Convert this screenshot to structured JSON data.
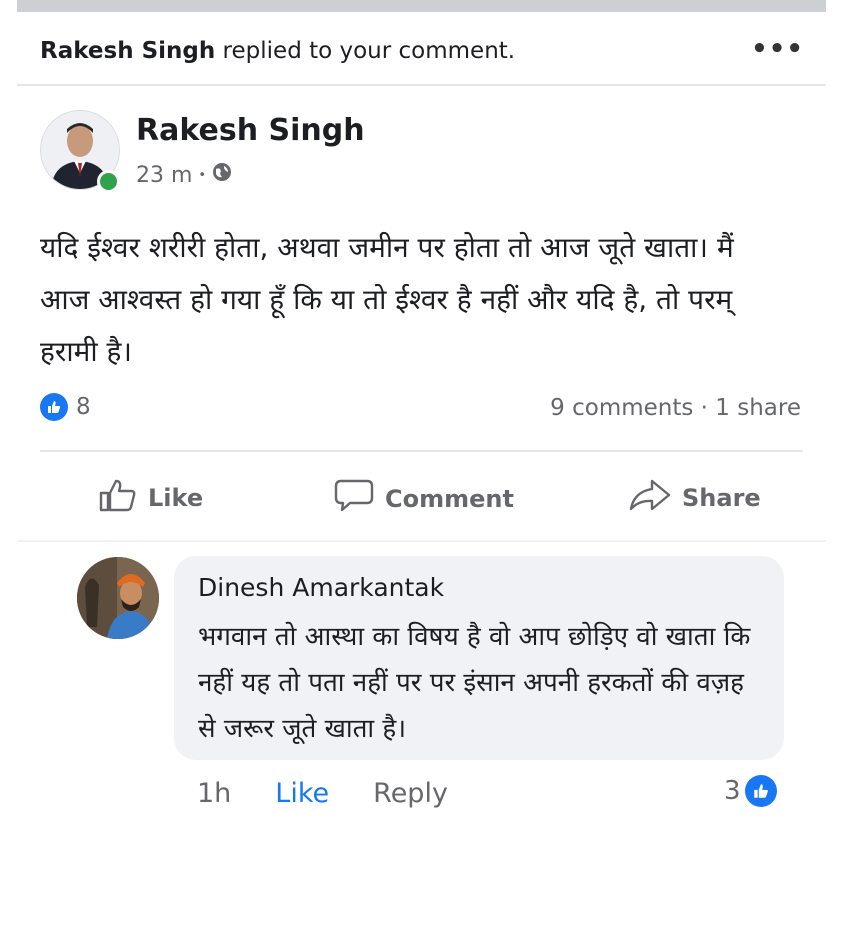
{
  "notification": {
    "actor": "Rakesh Singh",
    "action": " replied to your comment.",
    "more": "•••"
  },
  "post": {
    "author": "Rakesh Singh",
    "time": "23 m",
    "separator": "•",
    "audience_icon": "globe-icon",
    "text": "यदि ईश्वर शरीरी होता, अथवा जमीन पर होता तो आज जूते खाता। मैं आज आश्वस्त हो गया हूँ कि या तो ईश्वर है नहीं और यदि है, तो परम् हरामी है।",
    "like_count": "8",
    "stats": "9 comments · 1 share"
  },
  "actions": {
    "like": "Like",
    "comment": "Comment",
    "share": "Share"
  },
  "comment": {
    "author": "Dinesh Amarkantak",
    "text": "भगवान तो आस्था का विषय है वो आप छोड़िए वो खाता कि नहीं यह तो पता नहीं पर पर इंसान अपनी हरकतों की वज़ह से जरूर जूते खाता है।",
    "time": "1h",
    "like": "Like",
    "reply": "Reply",
    "reaction_count": "3"
  },
  "colors": {
    "brand": "#1877f2",
    "online": "#31a24c",
    "muted": "#65676b"
  }
}
